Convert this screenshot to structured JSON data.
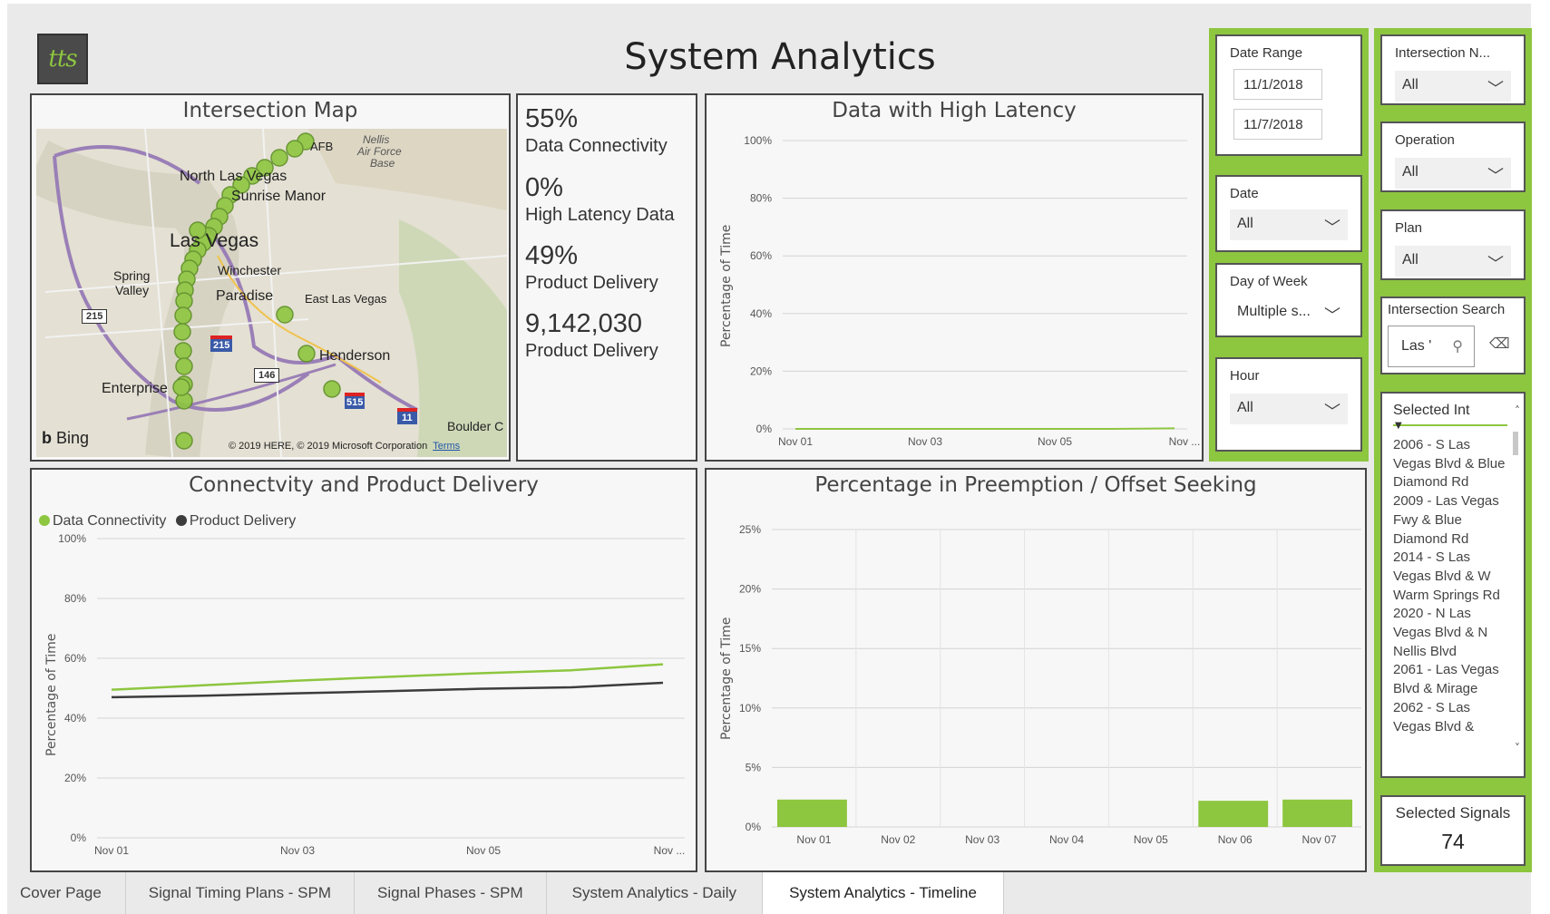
{
  "header": {
    "logo_text": "tts",
    "title": "System Analytics"
  },
  "map": {
    "title": "Intersection Map",
    "labels": [
      "Nellis",
      "Air Force",
      "Base",
      "North Las Vegas",
      "Sunrise Manor",
      "Las Vegas",
      "Spring",
      "Valley",
      "Winchester",
      "Paradise",
      "East Las Vegas",
      "Henderson",
      "Enterprise",
      "Boulder C"
    ],
    "shields": [
      "215",
      "215",
      "146",
      "515",
      "11"
    ],
    "nellis_afb_fragment": "AFB",
    "bing": "Bing",
    "copyright": "© 2019 HERE, © 2019 Microsoft Corporation",
    "terms_link": "Terms"
  },
  "kpis": [
    {
      "value": "55%",
      "label": "Data Connectivity"
    },
    {
      "value": "0%",
      "label": "High Latency Data"
    },
    {
      "value": "49%",
      "label": "Product Delivery"
    },
    {
      "value": "9,142,030",
      "label": "Product Delivery"
    }
  ],
  "colors": {
    "accent_green": "#8dc63f",
    "dark_series": "#3c3c3c"
  },
  "chart_data": [
    {
      "type": "line",
      "title": "Data with High Latency",
      "ylabel": "Percentage of Time",
      "ylim": [
        0,
        100
      ],
      "yticks": [
        "100%",
        "80%",
        "60%",
        "40%",
        "20%",
        "0%"
      ],
      "xticks": [
        "Nov 01",
        "Nov 03",
        "Nov 05",
        "Nov ..."
      ],
      "x": [
        "Nov 01",
        "Nov 02",
        "Nov 03",
        "Nov 04",
        "Nov 05",
        "Nov 06",
        "Nov 07"
      ],
      "series": [
        {
          "values": [
            0,
            0,
            0,
            0,
            0,
            0,
            0.2
          ]
        }
      ],
      "grid": true
    },
    {
      "type": "line",
      "title": "Connectvity and Product Delivery",
      "ylabel": "Percentage of Time",
      "ylim": [
        0,
        100
      ],
      "yticks": [
        "100%",
        "80%",
        "60%",
        "40%",
        "20%",
        "0%"
      ],
      "xticks": [
        "Nov 01",
        "Nov 03",
        "Nov 05",
        "Nov ..."
      ],
      "x": [
        "Nov 01",
        "Nov 02",
        "Nov 03",
        "Nov 04",
        "Nov 05",
        "Nov 06",
        "Nov 07"
      ],
      "legend_position": "top-left",
      "series": [
        {
          "name": "Data Connectivity",
          "color": "#8dc63f",
          "values": [
            49.5,
            51,
            52.5,
            53.8,
            55,
            56,
            58
          ]
        },
        {
          "name": "Product Delivery",
          "color": "#3c3c3c",
          "values": [
            47,
            47.5,
            48.3,
            49,
            49.8,
            50.3,
            51.8
          ]
        }
      ],
      "grid": true
    },
    {
      "type": "bar",
      "title": "Percentage in Preemption / Offset Seeking",
      "ylabel": "Percentage of Time",
      "ylim": [
        0,
        25
      ],
      "yticks": [
        "25%",
        "20%",
        "15%",
        "10%",
        "5%",
        "0%"
      ],
      "categories": [
        "Nov 01",
        "Nov 02",
        "Nov 03",
        "Nov 04",
        "Nov 05",
        "Nov 06",
        "Nov 07"
      ],
      "values": [
        2.3,
        0,
        0,
        0,
        0,
        2.2,
        2.3
      ],
      "grid": true
    }
  ],
  "filters": {
    "date_range": {
      "label": "Date Range",
      "start": "11/1/2018",
      "end": "11/7/2018"
    },
    "date": {
      "label": "Date",
      "value": "All"
    },
    "day_of_week": {
      "label": "Day of Week",
      "value": "Multiple s..."
    },
    "hour": {
      "label": "Hour",
      "value": "All"
    },
    "intersection_name": {
      "label": "Intersection N...",
      "value": "All"
    },
    "operation": {
      "label": "Operation",
      "value": "All"
    },
    "plan": {
      "label": "Plan",
      "value": "All"
    },
    "intersection_search": {
      "label": "Intersection Search",
      "value": "Las '"
    },
    "selected_intersections": {
      "header": "Selected Int",
      "items": [
        "2006 - S Las Vegas Blvd & Blue Diamond Rd",
        "2009 - Las Vegas Fwy & Blue Diamond Rd",
        "2014 - S Las Vegas Blvd & W Warm Springs Rd",
        "2020 - N Las Vegas Blvd & N Nellis Blvd",
        "2061 - Las Vegas Blvd & Mirage",
        "2062 - S Las Vegas Blvd &"
      ]
    },
    "selected_signals": {
      "label": "Selected Signals",
      "value": "74"
    }
  },
  "tabs": [
    "Cover Page",
    "Signal Timing Plans - SPM",
    "Signal Phases - SPM",
    "System Analytics - Daily",
    "System Analytics - Timeline"
  ],
  "active_tab": "System Analytics - Timeline"
}
